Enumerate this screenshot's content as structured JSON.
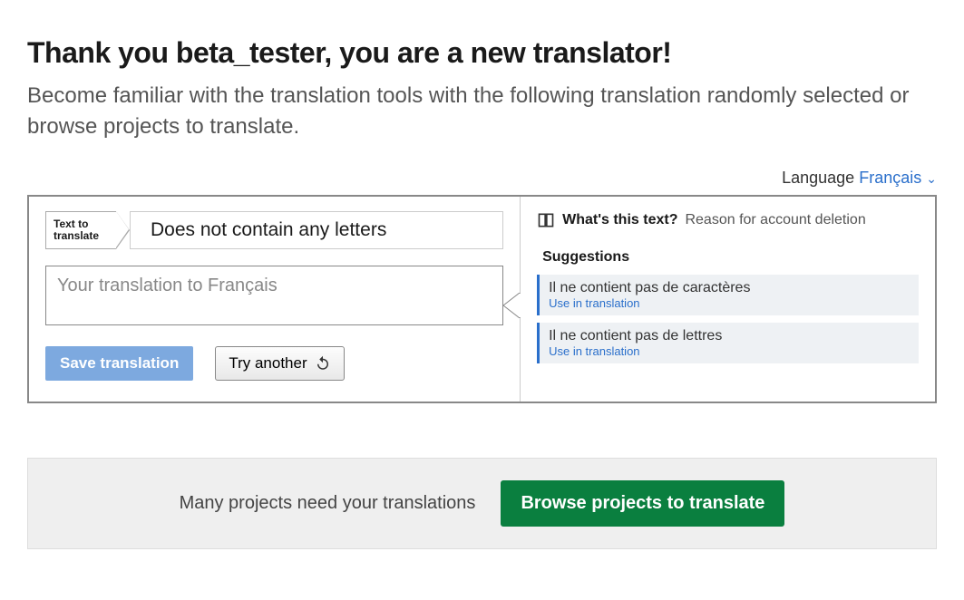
{
  "header": {
    "title": "Thank you beta_tester, you are a new translator!",
    "subtitle": "Become familiar with the translation tools with the following translation randomly selected or browse projects to translate."
  },
  "language": {
    "label": "Language",
    "current": "Français"
  },
  "translate": {
    "tag_label": "Text to translate",
    "source_text": "Does not contain any letters",
    "placeholder": "Your translation to Français",
    "save_label": "Save translation",
    "try_another_label": "Try another"
  },
  "context": {
    "whats_this_label": "What's this text?",
    "reason": "Reason for account deletion",
    "suggestions_title": "Suggestions",
    "use_label": "Use in translation",
    "suggestions": [
      {
        "text": "Il ne contient pas de caractères"
      },
      {
        "text": "Il ne contient pas de lettres"
      }
    ]
  },
  "footer": {
    "prompt": "Many projects need your translations",
    "browse_label": "Browse projects to translate"
  }
}
